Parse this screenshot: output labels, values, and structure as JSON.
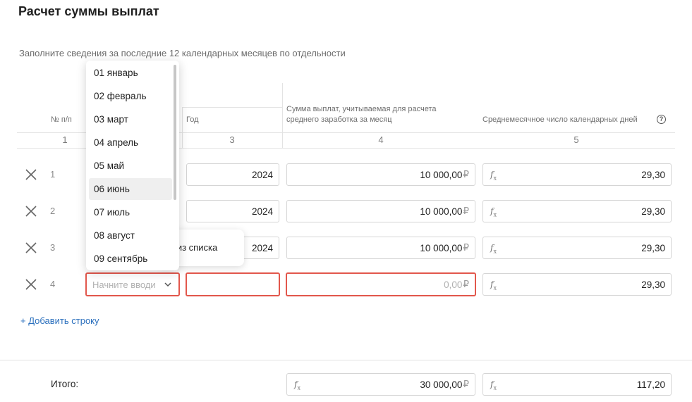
{
  "page": {
    "title": "Расчет суммы выплат",
    "subtitle": "Заполните сведения за последние 12 календарных месяцев по отдельности"
  },
  "table": {
    "headers": {
      "num": "№ п/п",
      "year": "Год",
      "amount_line1": "Сумма выплат, учитываемая для расчета",
      "amount_line2": "среднего заработка за месяц",
      "days": "Среднемесячное число календарных дней"
    },
    "column_numbers": [
      "1",
      "3",
      "4",
      "5"
    ],
    "rows": [
      {
        "num": "1",
        "year": "2024",
        "amount": "10 000,00",
        "days": "29,30"
      },
      {
        "num": "2",
        "year": "2024",
        "amount": "10 000,00",
        "days": "29,30"
      },
      {
        "num": "3",
        "year": "2024",
        "amount": "10 000,00",
        "days": "29,30"
      },
      {
        "num": "4",
        "month_placeholder": "Начните вводи",
        "year": "",
        "amount": "0,00",
        "days": "29,30"
      }
    ],
    "currency": "₽",
    "add_row_label": "+ Добавить строку",
    "total": {
      "label": "Итого:",
      "amount": "30 000,00",
      "days": "117,20"
    }
  },
  "dropdown": {
    "items": [
      "01 январь",
      "02 февраль",
      "03 март",
      "04 апрель",
      "05 май",
      "06 июнь",
      "07 июль",
      "08 август",
      "09 сентябрь"
    ],
    "highlighted": "06 июнь"
  },
  "tooltip": {
    "text": "е из списка"
  },
  "icons": {
    "delete": "close-icon",
    "formula": "fx-icon",
    "help": "help-icon",
    "chevron": "chevron-down-icon"
  },
  "colors": {
    "accent": "#2a6fbd",
    "error": "#e2574c",
    "border": "#d5d5d5"
  }
}
